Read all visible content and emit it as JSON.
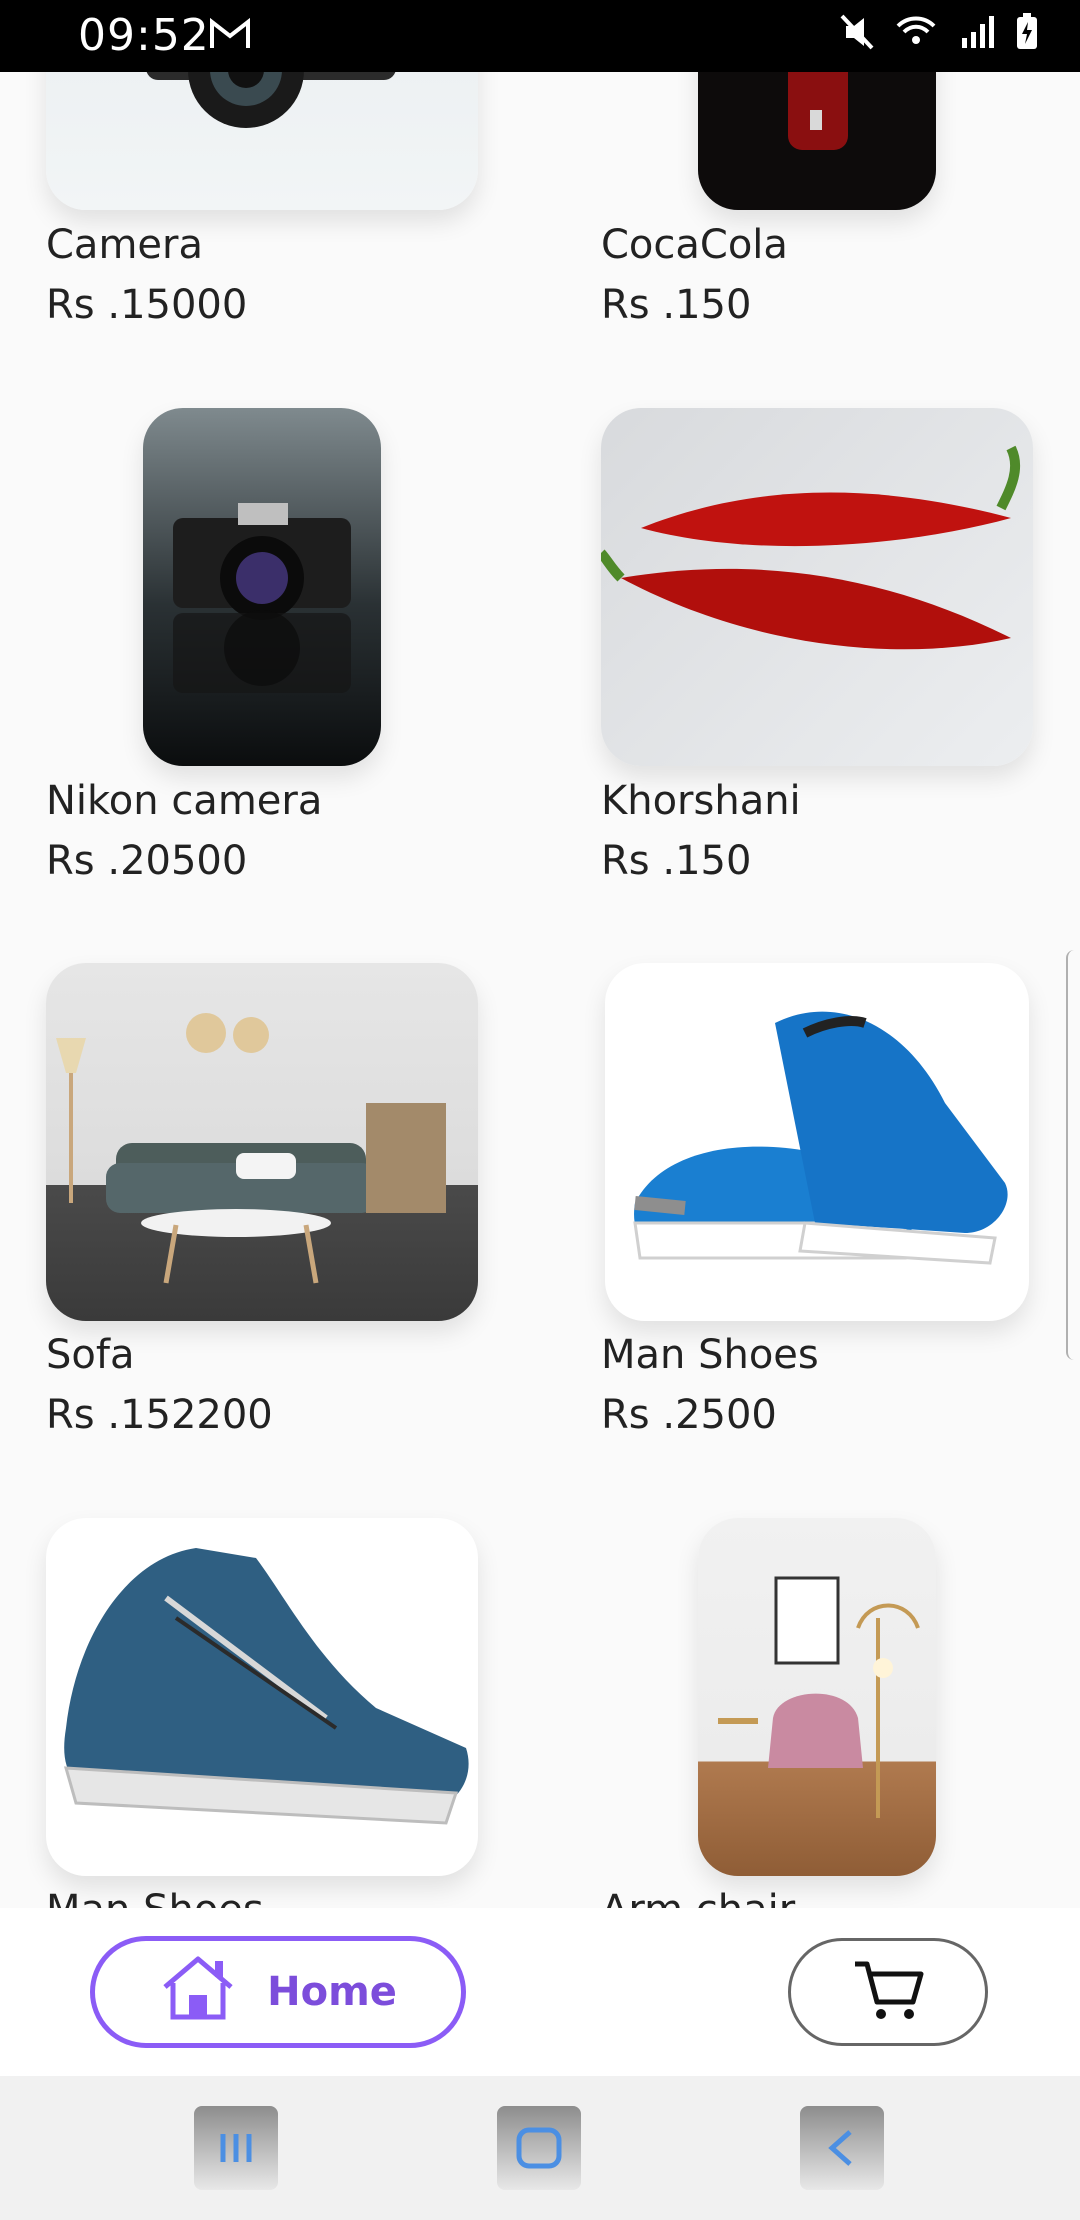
{
  "status_bar": {
    "time": "09:52",
    "icons": [
      "gmail-icon",
      "mute-icon",
      "wifi-icon",
      "signal-icon",
      "battery-charging-icon"
    ]
  },
  "products": [
    {
      "name": "Camera",
      "price": "Rs .15000"
    },
    {
      "name": "CocaCola",
      "price": "Rs .150"
    },
    {
      "name": "Nikon camera",
      "price": "Rs .20500"
    },
    {
      "name": "Khorshani",
      "price": "Rs .150"
    },
    {
      "name": "Sofa",
      "price": "Rs .152200"
    },
    {
      "name": "Man Shoes",
      "price": "Rs .2500"
    },
    {
      "name": "Man Shoes",
      "price": ""
    },
    {
      "name": "Arm chair",
      "price": ""
    }
  ],
  "bottom_nav": {
    "home_label": "Home"
  },
  "colors": {
    "accent": "#8b5cf6",
    "background": "#fafafa"
  }
}
